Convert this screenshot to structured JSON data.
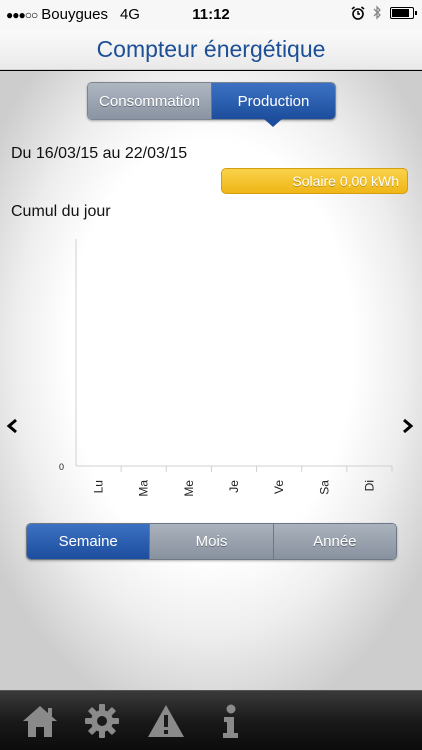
{
  "status_bar": {
    "signal": "●●●○○",
    "carrier": "Bouygues",
    "network": "4G",
    "time": "11:12",
    "battery_level": 0.9,
    "icons": [
      "alarm-icon",
      "bluetooth-icon",
      "battery-icon"
    ]
  },
  "header": {
    "title": "Compteur énergétique"
  },
  "top_segment": {
    "options": [
      "Consommation",
      "Production"
    ],
    "selected": "Production"
  },
  "date_range": "Du 16/03/15 au 22/03/15",
  "solar_badge": "Solaire 0,00 kWh",
  "chart_section_title": "Cumul du jour",
  "chart_data": {
    "type": "bar",
    "categories": [
      "Lu",
      "Ma",
      "Me",
      "Je",
      "Ve",
      "Sa",
      "Di"
    ],
    "series": [
      {
        "values": [
          0,
          0,
          0,
          0,
          0,
          0,
          0
        ]
      }
    ],
    "y_tick_labels": [
      "0"
    ],
    "ylim": [
      0,
      1
    ],
    "grid": false
  },
  "nav_arrows": {
    "left": "‹",
    "right": "›"
  },
  "bottom_segment": {
    "options": [
      "Semaine",
      "Mois",
      "Année"
    ],
    "selected": "Semaine"
  },
  "tab_bar": {
    "icons": [
      "home-icon",
      "gear-icon",
      "warning-icon",
      "info-icon"
    ],
    "color": "#8a8a8a"
  },
  "colors": {
    "brand_blue": "#1c4f96",
    "selected_segment": "#1d4e9e",
    "solar_yellow": "#f3c22b"
  }
}
